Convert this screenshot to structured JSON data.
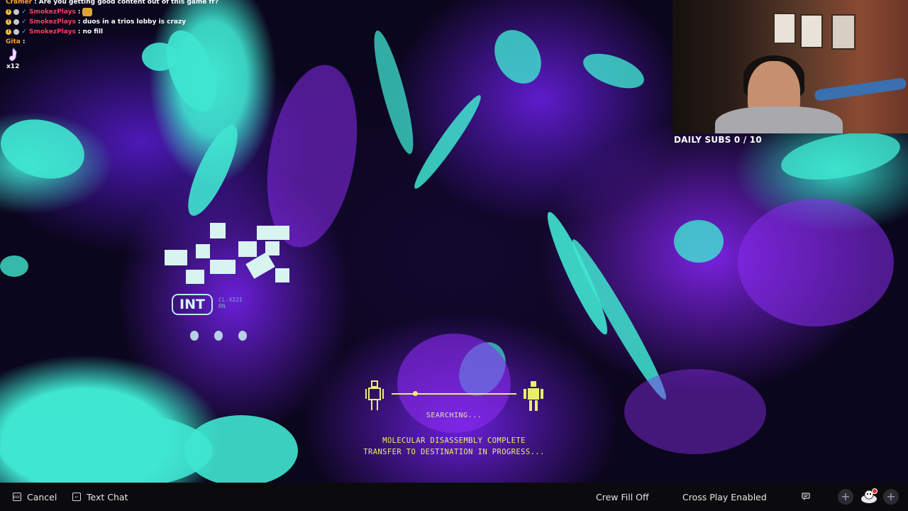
{
  "chat": {
    "messages": [
      {
        "user": "Cramer",
        "text": ": Are you getting good content out of this game fr?"
      },
      {
        "user": "SmokezPlays",
        "text": ": "
      },
      {
        "user": "SmokezPlays",
        "text": ": duos in a trios lobby is crazy"
      },
      {
        "user": "SmokezPlays",
        "text": ": no fill"
      },
      {
        "user": "Gita",
        "text": ":"
      }
    ],
    "cheer_count": "x12"
  },
  "stream": {
    "daily_subs": "DAILY SUBS 0 / 10"
  },
  "hud": {
    "int_label": "INT",
    "int_code": "CL-X22I",
    "int_sub": "RN"
  },
  "matchmaking": {
    "status": "SEARCHING...",
    "message_line1": "MOLECULAR DISASSEMBLY COMPLETE",
    "message_line2": "TRANSFER TO DESTINATION IN PROGRESS...",
    "accent_color": "#e8f06a"
  },
  "bottom_bar": {
    "cancel_label": "Cancel",
    "text_chat_label": "Text Chat",
    "crew_fill_label": "Crew Fill Off",
    "cross_play_label": "Cross Play Enabled",
    "icons": [
      "chat-bubble-icon",
      "add-friend-icon",
      "add-friend-icon",
      "player-avatar-icon"
    ]
  },
  "colors": {
    "cyan": "#3fe6d0",
    "purple": "#7a22e0",
    "bar_bg": "#0b0b0d"
  }
}
